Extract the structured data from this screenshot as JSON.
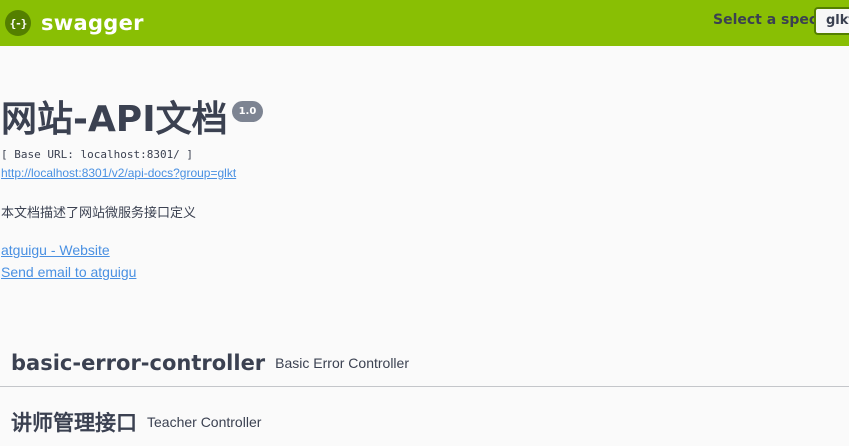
{
  "topbar": {
    "logo_icon_text": "{-}",
    "logo_text": "swagger",
    "spec_label": "Select a spec",
    "spec_selected": "glkt"
  },
  "info": {
    "title": "网站-API文档",
    "version": "1.0",
    "base_url": "[ Base URL: localhost:8301/ ]",
    "docs_url": "http://localhost:8301/v2/api-docs?group=glkt",
    "description": "本文档描述了网站微服务接口定义",
    "website_link": "atguigu - Website",
    "email_link": "Send email to atguigu"
  },
  "tags": [
    {
      "name": "basic-error-controller",
      "description": "Basic Error Controller"
    },
    {
      "name": "讲师管理接口",
      "description": "Teacher Controller"
    }
  ],
  "colors": {
    "topbar": "#89bf04",
    "link": "#4990e2",
    "text": "#3b4151",
    "version_badge": "#7d8492"
  }
}
